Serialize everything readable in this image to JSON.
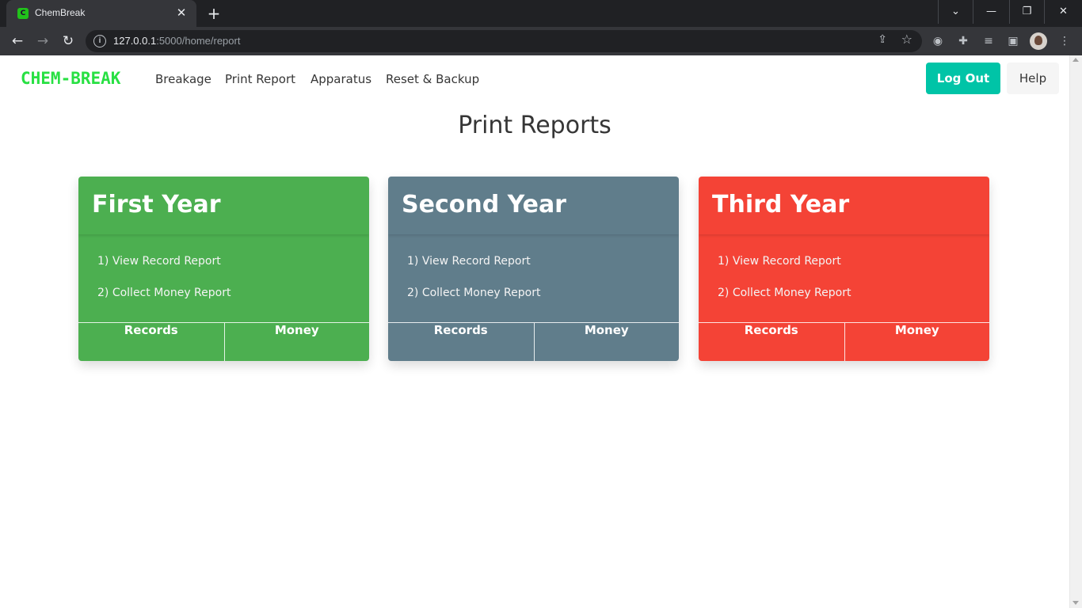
{
  "browser": {
    "tab_title": "ChemBreak",
    "favicon_text": "C",
    "url_host": "127.0.0.1",
    "url_rest": ":5000/home/report"
  },
  "nav": {
    "brand": "CHEM-BREAK",
    "links": [
      "Breakage",
      "Print Report",
      "Apparatus",
      "Reset & Backup"
    ],
    "logout": "Log Out",
    "help": "Help"
  },
  "page": {
    "title": "Print Reports"
  },
  "cards": [
    {
      "title": "First Year",
      "color": "#4caf50",
      "items": [
        "1) View Record Report",
        "2) Collect Money Report"
      ],
      "buttons": [
        "Records",
        "Money"
      ]
    },
    {
      "title": "Second Year",
      "color": "#607d8b",
      "items": [
        "1) View Record Report",
        "2) Collect Money Report"
      ],
      "buttons": [
        "Records",
        "Money"
      ]
    },
    {
      "title": "Third Year",
      "color": "#f44336",
      "items": [
        "1) View Record Report",
        "2) Collect Money Report"
      ],
      "buttons": [
        "Records",
        "Money"
      ]
    }
  ],
  "colors": {
    "brand": "#28e043",
    "logout_button": "#00c4a7",
    "help_button": "#f5f5f5"
  }
}
